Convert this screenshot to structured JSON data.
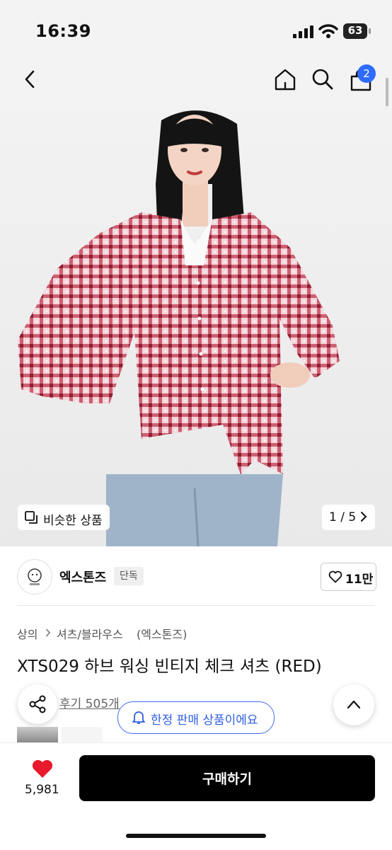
{
  "status_bar": {
    "time": "16:39",
    "battery": "63"
  },
  "nav": {
    "cart_count": "2"
  },
  "hero": {
    "similar_label": "비슷한 상품",
    "pager": "1 / 5"
  },
  "brand": {
    "name": "엑스톤즈",
    "tag": "단독",
    "likes": "11만"
  },
  "breadcrumb": {
    "level1": "상의",
    "level2": "셔츠/블라우스",
    "brand": "(엑스톤즈)"
  },
  "product": {
    "title": "XTS029 하브 워싱 빈티지 체크 셔츠 (RED)",
    "reviews": "후기 505개",
    "limited": "한정 판매 상품이에요"
  },
  "bottom": {
    "heart_count": "5,981",
    "buy_label": "구매하기"
  },
  "icons": [
    "back-icon",
    "home-icon",
    "search-icon",
    "bag-icon",
    "share-icon",
    "bell-icon",
    "heart-icon",
    "chevron-up-icon",
    "copy-icon",
    "chevron-right-icon"
  ],
  "colors": {
    "accent": "#2f6bff",
    "heart": "#e8192c",
    "buy_button": "#000000"
  }
}
